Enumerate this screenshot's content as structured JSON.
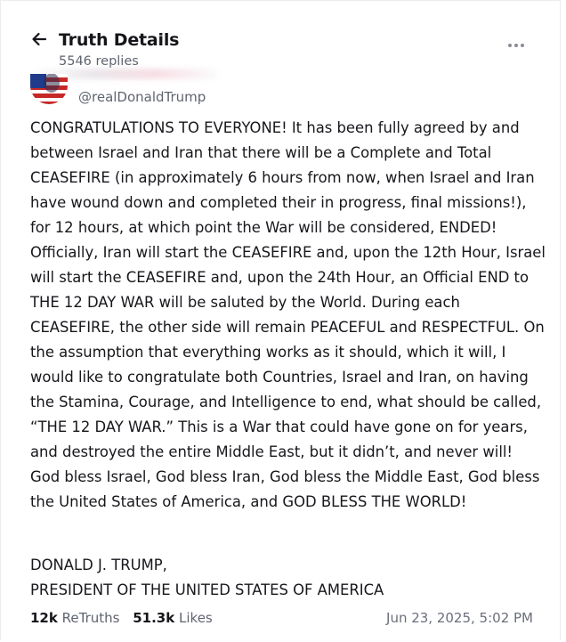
{
  "header": {
    "title": "Truth Details",
    "replies": "5546 replies",
    "back_icon": "arrow-left-icon",
    "more_icon": "more-horizontal-icon"
  },
  "post": {
    "handle": "@realDonaldTrump",
    "body": "CONGRATULATIONS TO EVERYONE! It has been fully agreed by and between Israel and Iran that there will be a Complete and Total CEASEFIRE (in approximately 6 hours from now, when Israel and Iran have wound down and completed their in progress, final missions!), for 12 hours, at which point the War will be considered, ENDED! Officially, Iran will start the CEASEFIRE and, upon the 12th Hour, Israel will start the CEASEFIRE and, upon the 24th Hour, an Official END to THE 12 DAY WAR will be saluted by the World. During each CEASEFIRE, the other side will remain PEACEFUL and RESPECTFUL. On the assumption that everything works as it should, which it will, I would like to congratulate both Countries, Israel and Iran, on having the Stamina, Courage, and Intelligence to end, what should be called, “THE 12 DAY WAR.” This is a War that could have gone on for years, and destroyed the entire Middle East, but it didn’t, and never will! God bless Israel, God bless Iran, God bless the Middle East, God bless the United States of America, and GOD BLESS THE WORLD!",
    "signature_line1": "DONALD J. TRUMP,",
    "signature_line2": "PRESIDENT OF THE UNITED STATES OF AMERICA",
    "retruths_count": "12k",
    "retruths_label": "ReTruths",
    "likes_count": "51.3k",
    "likes_label": "Likes",
    "timestamp": "Jun 23, 2025, 5:02 PM"
  }
}
